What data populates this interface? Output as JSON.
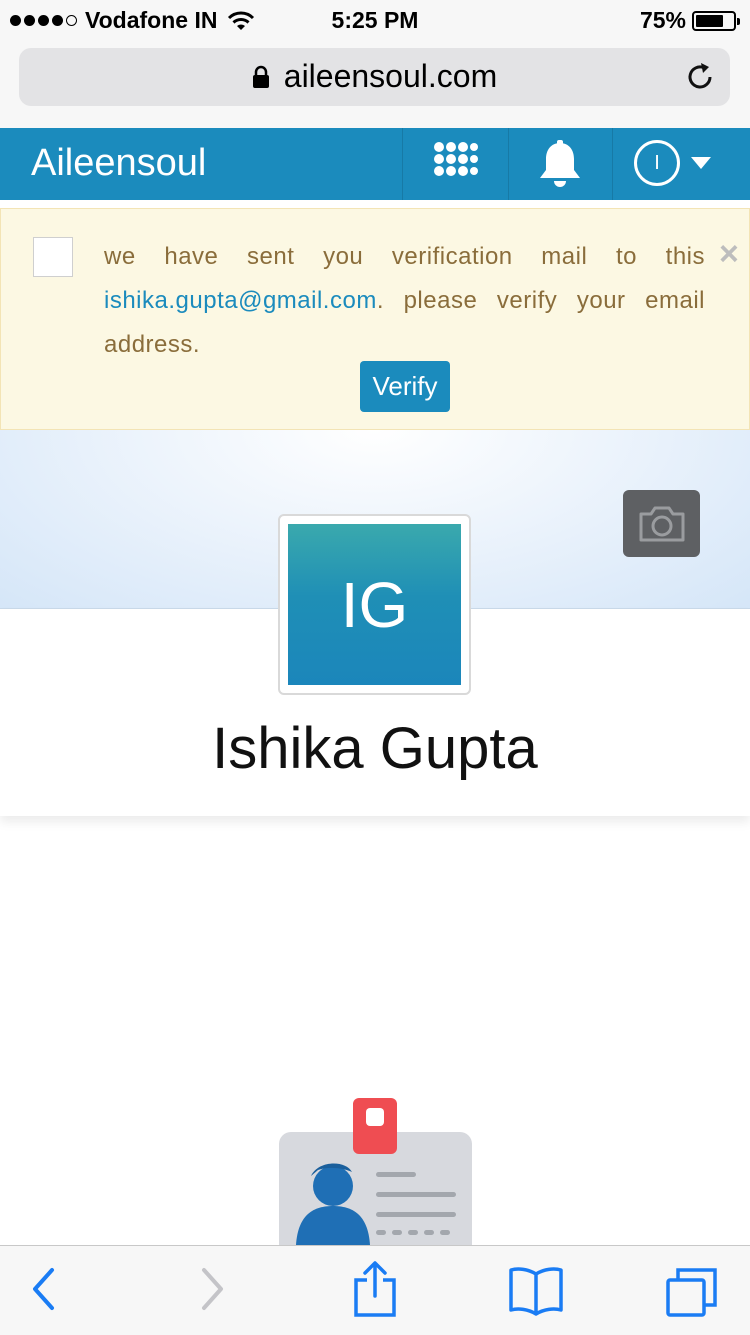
{
  "status_bar": {
    "carrier": "Vodafone IN",
    "time": "5:25 PM",
    "battery": "75%",
    "battery_level": 0.75,
    "signal_bars": 4,
    "signal_max": 5
  },
  "browser": {
    "url": "aileensoul.com",
    "lock_icon": "lock-icon",
    "reload_icon": "reload-icon"
  },
  "navbar": {
    "brand": "Aileensoul",
    "avatar_initial": "I",
    "icons": [
      "apps-grid-icon",
      "bell-icon",
      "caret-down-icon"
    ],
    "color": "#1b8bbd"
  },
  "alert": {
    "text_before": "we have sent you verification mail to this ",
    "email": "ishika.gupta@gmail.com",
    "text_after": ". please verify your email address.",
    "close": "×",
    "verify_label": "Verify",
    "background": "#fcf8e3",
    "text_color": "#8a6d3b"
  },
  "profile": {
    "initials": "IG",
    "name": "Ishika Gupta",
    "camera_icon": "camera-icon"
  },
  "illustration": {
    "icon": "id-card-icon"
  },
  "toolbar": {
    "icons": [
      "back-icon",
      "forward-icon",
      "share-icon",
      "bookmarks-icon",
      "tabs-icon"
    ],
    "accent": "#1a7cf4"
  }
}
